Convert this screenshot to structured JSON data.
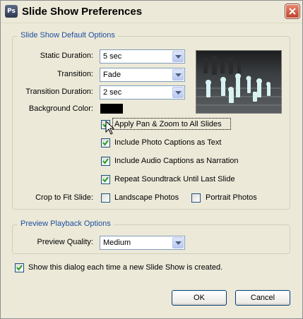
{
  "window": {
    "title": "Slide Show Preferences",
    "app_icon": "app-icon",
    "close_icon": "close-x-icon"
  },
  "default_options": {
    "legend": "Slide Show Default Options",
    "static_duration": {
      "label": "Static Duration:",
      "value": "5 sec"
    },
    "transition": {
      "label": "Transition:",
      "value": "Fade"
    },
    "transition_duration": {
      "label": "Transition Duration:",
      "value": "2 sec"
    },
    "background_color": {
      "label": "Background Color:",
      "value": "#000000"
    },
    "checkboxes": [
      {
        "label": "Apply Pan & Zoom to All Slides",
        "checked": true
      },
      {
        "label": "Include Photo Captions as Text",
        "checked": true
      },
      {
        "label": "Include Audio Captions as Narration",
        "checked": true
      },
      {
        "label": "Repeat Soundtrack Until Last Slide",
        "checked": true
      }
    ],
    "crop": {
      "label": "Crop to Fit Slide:",
      "landscape": {
        "label": "Landscape Photos",
        "checked": false
      },
      "portrait": {
        "label": "Portrait Photos",
        "checked": false
      }
    }
  },
  "preview_options": {
    "legend": "Preview Playback Options",
    "quality": {
      "label": "Preview Quality:",
      "value": "Medium"
    }
  },
  "show_dialog": {
    "label": "Show this dialog each time a new Slide Show is created.",
    "checked": true
  },
  "buttons": {
    "ok": "OK",
    "cancel": "Cancel"
  },
  "colors": {
    "legend_text": "#1e4fa0",
    "checkmark": "#21a121",
    "button_border": "#003c74"
  }
}
